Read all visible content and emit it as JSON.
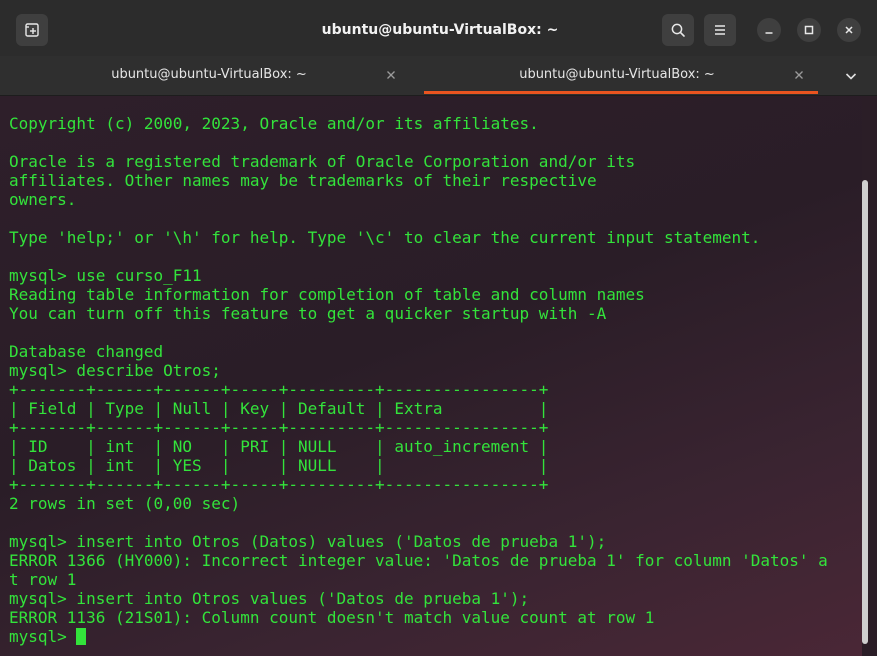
{
  "window": {
    "title": "ubuntu@ubuntu-VirtualBox: ~"
  },
  "tabs": [
    {
      "label": "ubuntu@ubuntu-VirtualBox: ~",
      "active": false
    },
    {
      "label": "ubuntu@ubuntu-VirtualBox: ~",
      "active": true
    }
  ],
  "icons": {
    "new_tab": "new-tab-icon",
    "search": "search-icon",
    "menu": "hamburger-menu-icon",
    "minimize": "minimize-icon",
    "maximize": "maximize-icon",
    "close": "close-icon",
    "tabs_menu": "chevron-down-icon"
  },
  "colors": {
    "terminal_text": "#33e33b",
    "tab_indicator": "#e95420"
  },
  "terminal": {
    "lines": [
      "Copyright (c) 2000, 2023, Oracle and/or its affiliates.",
      "",
      "Oracle is a registered trademark of Oracle Corporation and/or its",
      "affiliates. Other names may be trademarks of their respective",
      "owners.",
      "",
      "Type 'help;' or '\\h' for help. Type '\\c' to clear the current input statement.",
      "",
      "mysql> use curso_F11",
      "Reading table information for completion of table and column names",
      "You can turn off this feature to get a quicker startup with -A",
      "",
      "Database changed",
      "mysql> describe Otros;",
      "+-------+------+------+-----+---------+----------------+",
      "| Field | Type | Null | Key | Default | Extra          |",
      "+-------+------+------+-----+---------+----------------+",
      "| ID    | int  | NO   | PRI | NULL    | auto_increment |",
      "| Datos | int  | YES  |     | NULL    |                |",
      "+-------+------+------+-----+---------+----------------+",
      "2 rows in set (0,00 sec)",
      "",
      "mysql> insert into Otros (Datos) values ('Datos de prueba 1');",
      "ERROR 1366 (HY000): Incorrect integer value: 'Datos de prueba 1' for column 'Datos' a",
      "t row 1",
      "mysql> insert into Otros values ('Datos de prueba 1');",
      "ERROR 1136 (21S01): Column count doesn't match value count at row 1"
    ],
    "prompt": "mysql> "
  }
}
